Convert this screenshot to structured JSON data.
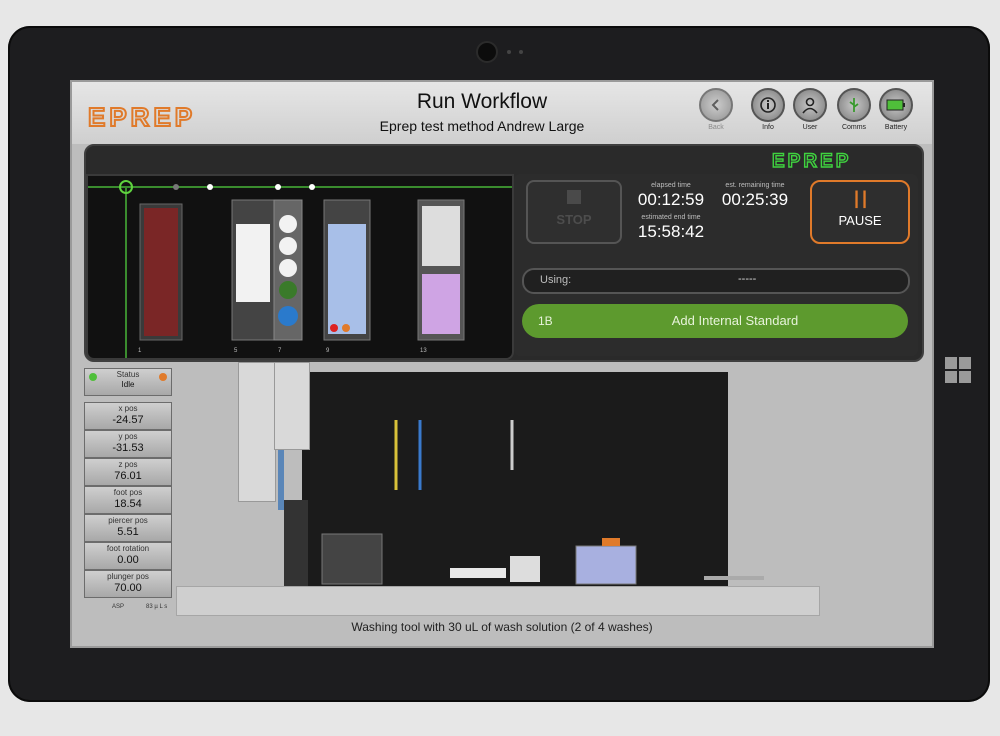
{
  "app": {
    "title": "Run Workflow",
    "subtitle": "Eprep test method Andrew Large",
    "logo_text": "EPREP",
    "panel_logo_text": "EPREP"
  },
  "header_buttons": [
    {
      "label": "Back",
      "icon": "chevron-left-icon",
      "enabled": false
    },
    {
      "label": "Info",
      "icon": "info-icon",
      "enabled": true
    },
    {
      "label": "User",
      "icon": "user-icon",
      "enabled": true
    },
    {
      "label": "Comms",
      "icon": "usb-icon",
      "enabled": true
    },
    {
      "label": "Battery",
      "icon": "battery-icon",
      "enabled": true
    }
  ],
  "deck": {
    "positions": [
      "1",
      "5",
      "7",
      "9",
      "13"
    ]
  },
  "controls": {
    "stop_label": "STOP",
    "pause_label": "PAUSE",
    "elapsed_label": "elapsed time",
    "elapsed_value": "00:12:59",
    "remaining_label": "est. remaining time",
    "remaining_value": "00:25:39",
    "end_label": "estimated end time",
    "end_value": "15:58:42",
    "using_label": "Using:",
    "using_value": "-----",
    "step_number": "1B",
    "step_name": "Add Internal Standard"
  },
  "status_panel": {
    "status_label": "Status",
    "status_value": "Idle",
    "x_label": "x pos",
    "x_value": "-24.57",
    "y_label": "y pos",
    "y_value": "-31.53",
    "z_label": "z pos",
    "z_value": "76.01",
    "foot_label": "foot pos",
    "foot_value": "18.54",
    "piercer_label": "piercer pos",
    "piercer_value": "5.51",
    "rotation_label": "foot rotation",
    "rotation_value": "0.00",
    "plunger_label": "plunger pos",
    "plunger_value": "70.00",
    "footer_left": "ASP",
    "footer_right": "83 µ L s"
  },
  "status_message": "Washing tool with 30 uL of wash solution (2 of 4 washes)",
  "colors": {
    "accent_green": "#5d9a2e",
    "accent_orange": "#e07a2a",
    "logo_orange": "#e07a2a",
    "logo_green": "#3fd23f"
  }
}
